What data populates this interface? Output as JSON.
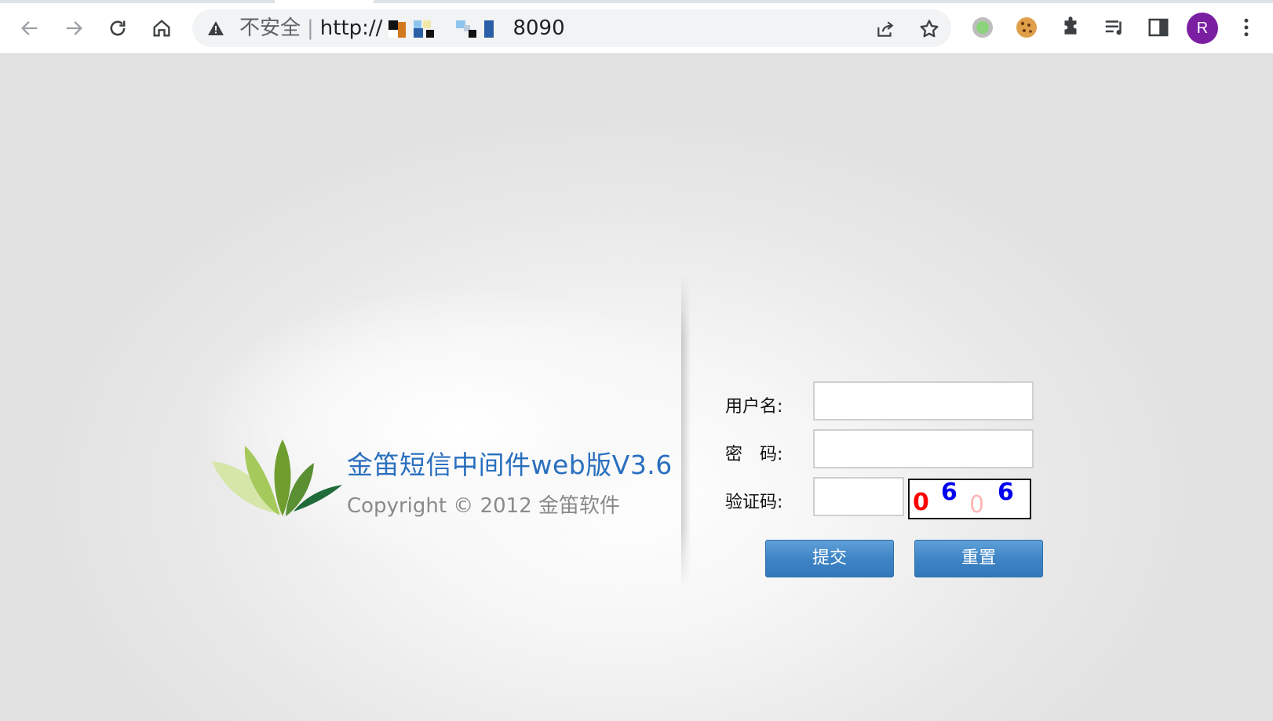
{
  "browser": {
    "url_security_label": "不安全",
    "url_separator": "|",
    "url_prefix": "http://",
    "url_port": "8090",
    "profile_initial": "R"
  },
  "product": {
    "title": "金笛短信中间件web版V3.6",
    "copyright": "Copyright © 2012 金笛软件"
  },
  "login_form": {
    "username_label": "用户名:",
    "username_value": "",
    "password_label": "密　码:",
    "password_value": "",
    "captcha_label": "验证码:",
    "captcha_value": "",
    "captcha_chars": [
      "0",
      "6",
      "0",
      "6"
    ],
    "captcha_colors": [
      "#ff0000",
      "#0000ee",
      "#ffb6b6",
      "#0000ee"
    ],
    "submit_label": "提交",
    "reset_label": "重置"
  },
  "icons": {
    "back": "arrow-left-icon",
    "forward": "arrow-right-icon",
    "reload": "reload-icon",
    "home": "home-icon",
    "warning": "warning-triangle-icon",
    "share": "share-icon",
    "bookmark": "star-icon",
    "ext1": "green-dot-extension-icon",
    "ext2": "cookie-icon",
    "extensions": "puzzle-icon",
    "reading_list": "reading-list-icon",
    "side_panel": "side-panel-icon",
    "menu": "kebab-menu-icon"
  },
  "colors": {
    "title_blue": "#2a6fbf",
    "button_blue": "#3f85c6",
    "avatar_purple": "#7b1fa2"
  }
}
